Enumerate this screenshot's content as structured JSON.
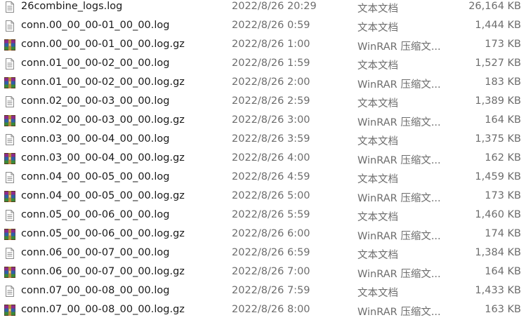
{
  "files": [
    {
      "name": "26combine_logs.log",
      "date": "2022/8/26 20:29",
      "type": "文本文档",
      "size": "26,164 KB",
      "icon": "text-file-icon"
    },
    {
      "name": "conn.00_00_00-01_00_00.log",
      "date": "2022/8/26 0:59",
      "type": "文本文档",
      "size": "1,444 KB",
      "icon": "text-file-icon"
    },
    {
      "name": "conn.00_00_00-01_00_00.log.gz",
      "date": "2022/8/26 1:00",
      "type": "WinRAR 压缩文...",
      "size": "173 KB",
      "icon": "winrar-archive-icon"
    },
    {
      "name": "conn.01_00_00-02_00_00.log",
      "date": "2022/8/26 1:59",
      "type": "文本文档",
      "size": "1,527 KB",
      "icon": "text-file-icon"
    },
    {
      "name": "conn.01_00_00-02_00_00.log.gz",
      "date": "2022/8/26 2:00",
      "type": "WinRAR 压缩文...",
      "size": "183 KB",
      "icon": "winrar-archive-icon"
    },
    {
      "name": "conn.02_00_00-03_00_00.log",
      "date": "2022/8/26 2:59",
      "type": "文本文档",
      "size": "1,389 KB",
      "icon": "text-file-icon"
    },
    {
      "name": "conn.02_00_00-03_00_00.log.gz",
      "date": "2022/8/26 3:00",
      "type": "WinRAR 压缩文...",
      "size": "164 KB",
      "icon": "winrar-archive-icon"
    },
    {
      "name": "conn.03_00_00-04_00_00.log",
      "date": "2022/8/26 3:59",
      "type": "文本文档",
      "size": "1,375 KB",
      "icon": "text-file-icon"
    },
    {
      "name": "conn.03_00_00-04_00_00.log.gz",
      "date": "2022/8/26 4:00",
      "type": "WinRAR 压缩文...",
      "size": "162 KB",
      "icon": "winrar-archive-icon"
    },
    {
      "name": "conn.04_00_00-05_00_00.log",
      "date": "2022/8/26 4:59",
      "type": "文本文档",
      "size": "1,459 KB",
      "icon": "text-file-icon"
    },
    {
      "name": "conn.04_00_00-05_00_00.log.gz",
      "date": "2022/8/26 5:00",
      "type": "WinRAR 压缩文...",
      "size": "173 KB",
      "icon": "winrar-archive-icon"
    },
    {
      "name": "conn.05_00_00-06_00_00.log",
      "date": "2022/8/26 5:59",
      "type": "文本文档",
      "size": "1,460 KB",
      "icon": "text-file-icon"
    },
    {
      "name": "conn.05_00_00-06_00_00.log.gz",
      "date": "2022/8/26 6:00",
      "type": "WinRAR 压缩文...",
      "size": "174 KB",
      "icon": "winrar-archive-icon"
    },
    {
      "name": "conn.06_00_00-07_00_00.log",
      "date": "2022/8/26 6:59",
      "type": "文本文档",
      "size": "1,384 KB",
      "icon": "text-file-icon"
    },
    {
      "name": "conn.06_00_00-07_00_00.log.gz",
      "date": "2022/8/26 7:00",
      "type": "WinRAR 压缩文...",
      "size": "164 KB",
      "icon": "winrar-archive-icon"
    },
    {
      "name": "conn.07_00_00-08_00_00.log",
      "date": "2022/8/26 7:59",
      "type": "文本文档",
      "size": "1,433 KB",
      "icon": "text-file-icon"
    },
    {
      "name": "conn.07_00_00-08_00_00.log.gz",
      "date": "2022/8/26 8:00",
      "type": "WinRAR 压缩文...",
      "size": "163 KB",
      "icon": "winrar-archive-icon"
    }
  ]
}
